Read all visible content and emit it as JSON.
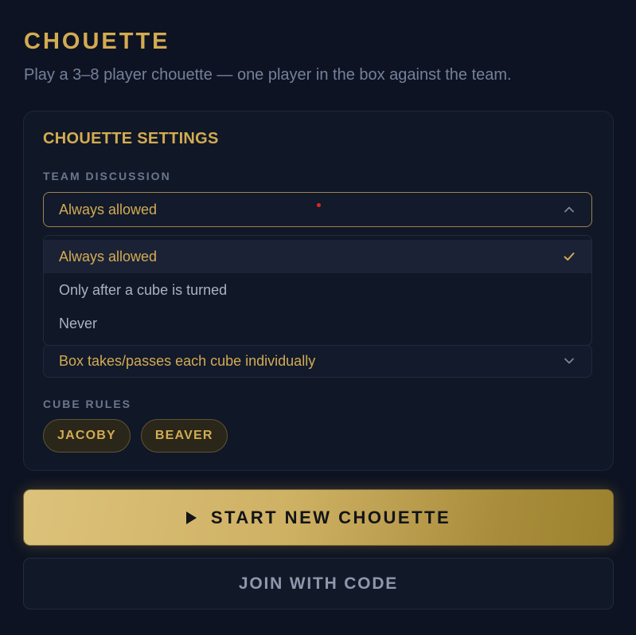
{
  "header": {
    "title": "CHOUETTE",
    "subtitle": "Play a 3–8 player chouette — one player in the box against the team."
  },
  "settings": {
    "title": "CHOUETTE SETTINGS",
    "team_discussion": {
      "label": "TEAM DISCUSSION",
      "value": "Always allowed",
      "expanded": true,
      "options": [
        {
          "label": "Always allowed",
          "selected": true
        },
        {
          "label": "Only after a cube is turned",
          "selected": false
        },
        {
          "label": "Never",
          "selected": false
        }
      ]
    },
    "cube_handling": {
      "value": "Box takes/passes each cube individually"
    },
    "cube_rules": {
      "label": "CUBE RULES",
      "chips": [
        "JACOBY",
        "BEAVER"
      ]
    }
  },
  "actions": {
    "start_label": "START NEW CHOUETTE",
    "join_label": "JOIN WITH CODE"
  },
  "icons": {
    "chevron_up": "chevron-up-icon",
    "chevron_down": "chevron-down-icon",
    "check": "check-icon",
    "play": "play-icon"
  },
  "colors": {
    "accent_gold": "#d3ab52",
    "background": "#0d1322",
    "muted_text": "#74809a"
  }
}
